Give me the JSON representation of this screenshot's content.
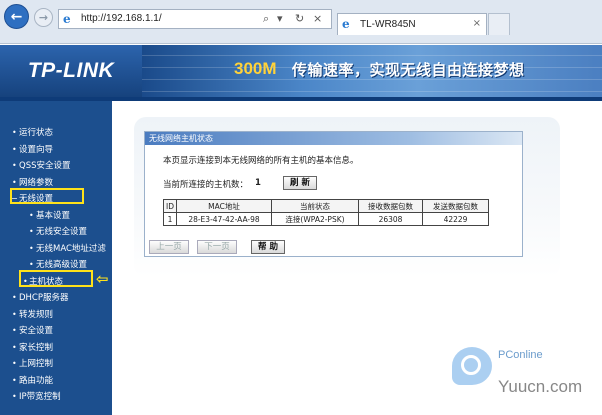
{
  "browser": {
    "url": "http://192.168.1.1/",
    "tab_title": "TL-WR845N",
    "tab_close": "×",
    "search_glyph": "⌕",
    "dropdown_glyph": "▾",
    "refresh_glyph": "↻",
    "stop_glyph": "×"
  },
  "banner": {
    "logo": "TP-LINK",
    "slogan_speed": "300M",
    "slogan_text": "传输速率，实现无线自由连接梦想"
  },
  "sidebar": {
    "items": [
      {
        "label": "运行状态"
      },
      {
        "label": "设置向导"
      },
      {
        "label": "QSS安全设置"
      },
      {
        "label": "网络参数"
      },
      {
        "label": "无线设置"
      },
      {
        "label": "基本设置"
      },
      {
        "label": "无线安全设置"
      },
      {
        "label": "无线MAC地址过滤"
      },
      {
        "label": "无线高级设置"
      },
      {
        "label": "主机状态"
      },
      {
        "label": "DHCP服务器"
      },
      {
        "label": "转发规则"
      },
      {
        "label": "安全设置"
      },
      {
        "label": "家长控制"
      },
      {
        "label": "上网控制"
      },
      {
        "label": "路由功能"
      },
      {
        "label": "IP带宽控制"
      }
    ]
  },
  "panel": {
    "title": "无线网络主机状态",
    "description": "本页显示连接到本无线网络的所有主机的基本信息。",
    "count_label": "当前所连接的主机数：",
    "count_value": "1",
    "refresh_label": "刷 新",
    "table": {
      "headers": [
        "ID",
        "MAC地址",
        "当前状态",
        "接收数据包数",
        "发送数据包数"
      ],
      "rows": [
        [
          "1",
          "28-E3-47-42-AA-98",
          "连接(WPA2-PSK)",
          "26308",
          "42229"
        ]
      ]
    },
    "prev_label": "上一页",
    "next_label": "下一页",
    "help_label": "帮 助"
  },
  "watermark": {
    "pconline": "PConline",
    "yuucn": "Yuucn.com"
  },
  "colors": {
    "sidebar_bg": "#1c4f8e",
    "highlight": "#ffe21a",
    "slogan_accent": "#ffd23a"
  }
}
